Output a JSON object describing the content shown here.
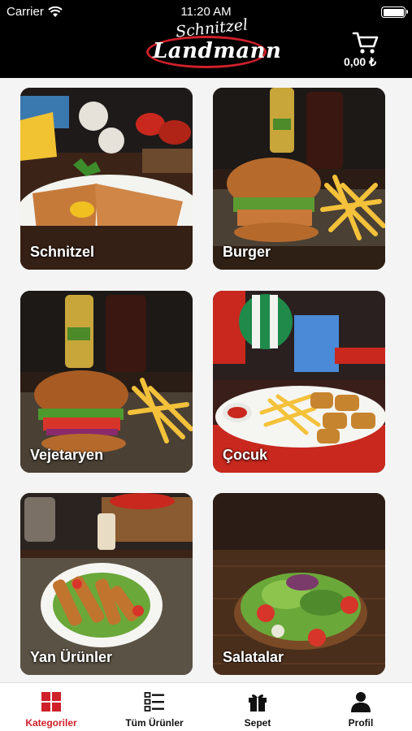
{
  "status_bar": {
    "carrier": "Carrier",
    "time": "11:20 AM"
  },
  "header": {
    "logo_top": "Schnitzel",
    "logo_main": "Landmann",
    "cart_total": "0,00 ₺"
  },
  "categories": [
    {
      "label": "Schnitzel"
    },
    {
      "label": "Burger"
    },
    {
      "label": "Vejetaryen"
    },
    {
      "label": "Çocuk"
    },
    {
      "label": "Yan Ürünler"
    },
    {
      "label": "Salatalar"
    }
  ],
  "tabbar": {
    "items": [
      {
        "label": "Kategoriler",
        "icon": "grid-icon",
        "active": true
      },
      {
        "label": "Tüm Ürünler",
        "icon": "list-icon",
        "active": false
      },
      {
        "label": "Sepet",
        "icon": "gift-icon",
        "active": false
      },
      {
        "label": "Profil",
        "icon": "person-icon",
        "active": false
      }
    ]
  },
  "colors": {
    "accent": "#d0202a",
    "header_bg": "#000000",
    "background": "#f4f4f4"
  }
}
